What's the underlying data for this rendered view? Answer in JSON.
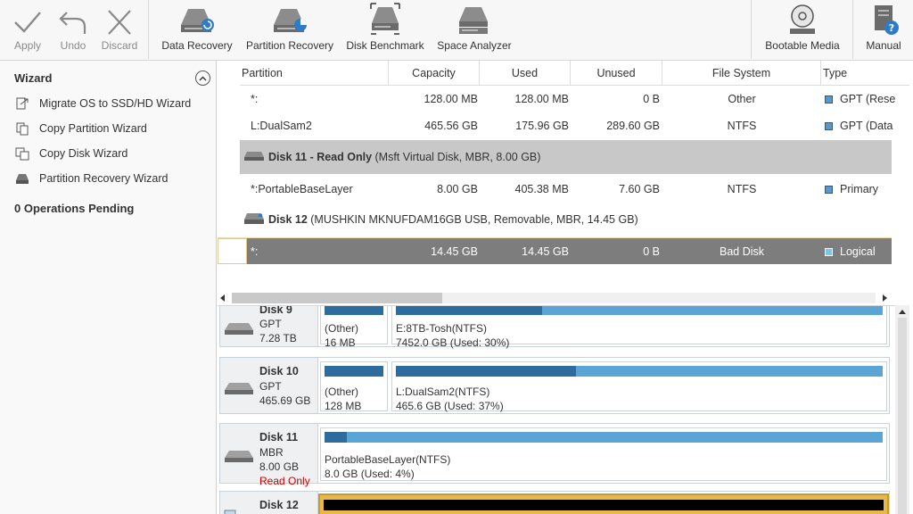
{
  "toolbar": {
    "apply": "Apply",
    "undo": "Undo",
    "discard": "Discard",
    "data_recovery": "Data Recovery",
    "partition_recovery": "Partition Recovery",
    "disk_benchmark": "Disk Benchmark",
    "space_analyzer": "Space Analyzer",
    "bootable_media": "Bootable Media",
    "manual": "Manual"
  },
  "wizard": {
    "title": "Wizard",
    "items": [
      {
        "label": "Migrate OS to SSD/HD Wizard",
        "icon": "migrate-os-icon"
      },
      {
        "label": "Copy Partition Wizard",
        "icon": "copy-partition-icon"
      },
      {
        "label": "Copy Disk Wizard",
        "icon": "copy-disk-icon"
      },
      {
        "label": "Partition Recovery Wizard",
        "icon": "partition-recovery-icon"
      }
    ],
    "operations_pending": "0 Operations Pending"
  },
  "table": {
    "columns": [
      "Partition",
      "Capacity",
      "Used",
      "Unused",
      "File System",
      "Type"
    ],
    "rows": [
      {
        "partition": "*:",
        "capacity": "128.00 MB",
        "used": "128.00 MB",
        "unused": "0 B",
        "fs": "Other",
        "type": "GPT (Rese"
      },
      {
        "partition": "L:DualSam2",
        "capacity": "465.56 GB",
        "used": "175.96 GB",
        "unused": "289.60 GB",
        "fs": "NTFS",
        "type": "GPT (Data"
      },
      {
        "partition": "*:PortableBaseLayer",
        "capacity": "8.00 GB",
        "used": "405.38 MB",
        "unused": "7.60 GB",
        "fs": "NTFS",
        "type": "Primary"
      },
      {
        "partition": "*:",
        "capacity": "14.45 GB",
        "used": "14.45 GB",
        "unused": "0 B",
        "fs": "Bad Disk",
        "type": "Logical"
      }
    ],
    "disk11": {
      "name": "Disk 11 - Read Only",
      "detail": " (Msft Virtual Disk, MBR, 8.00 GB)"
    },
    "disk12": {
      "name": "Disk 12",
      "detail": " (MUSHKIN MKNUFDAM16GB USB, Removable, MBR, 14.45 GB)"
    }
  },
  "map": {
    "disk9": {
      "name": "Disk 9",
      "style": "GPT",
      "size": "7.28 TB",
      "parts": [
        {
          "t1": "(Other)",
          "t2": "16 MB"
        },
        {
          "t1": "E:8TB-Tosh(NTFS)",
          "t2": "7452.0 GB (Used: 30%)",
          "used": 0.3
        }
      ]
    },
    "disk10": {
      "name": "Disk 10",
      "style": "GPT",
      "size": "465.69 GB",
      "parts": [
        {
          "t1": "(Other)",
          "t2": "128 MB"
        },
        {
          "t1": "L:DualSam2(NTFS)",
          "t2": "465.6 GB (Used: 37%)",
          "used": 0.37
        }
      ]
    },
    "disk11": {
      "name": "Disk 11",
      "style": "MBR",
      "size": "8.00 GB",
      "status": "Read Only",
      "parts": [
        {
          "t1": "PortableBaseLayer(NTFS)",
          "t2": "8.0 GB (Used: 4%)",
          "used": 0.04
        }
      ]
    },
    "disk12": {
      "name": "Disk 12"
    }
  },
  "colors": {
    "accent": "#5ba5d6",
    "used": "#2f6c9e",
    "selected_row": "#7d7d7d",
    "disk_row": "#c8c8c8",
    "read_only": "#cc0000",
    "highlight": "#e8b94a"
  }
}
